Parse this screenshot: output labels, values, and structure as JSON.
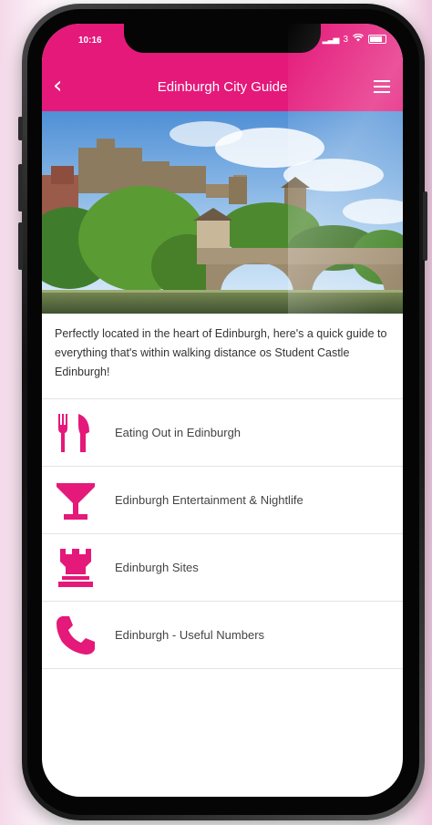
{
  "status_bar": {
    "time": "10:16",
    "signal_text": "3"
  },
  "header": {
    "title": "Edinburgh City Guide",
    "back_icon": "chevron-left-icon",
    "menu_icon": "hamburger-menu-icon"
  },
  "intro": {
    "text": "Perfectly located in the heart of Edinburgh, here's a quick guide to everything that's within walking distance os Student Castle Edinburgh!"
  },
  "menu_items": [
    {
      "label": "Eating Out in Edinburgh",
      "icon": "fork-knife-icon"
    },
    {
      "label": "Edinburgh Entertainment & Nightlife",
      "icon": "cocktail-glass-icon"
    },
    {
      "label": "Edinburgh Sites",
      "icon": "castle-tower-icon"
    },
    {
      "label": "Edinburgh - Useful Numbers",
      "icon": "phone-icon"
    }
  ],
  "colors": {
    "brand_pink": "#e4197a",
    "text": "#444444"
  }
}
